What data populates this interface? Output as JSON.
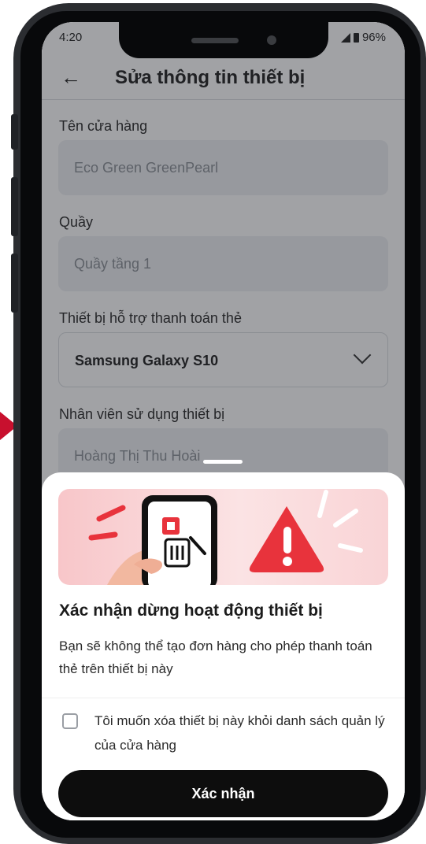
{
  "status_bar": {
    "time": "4:20",
    "battery": "96%"
  },
  "header": {
    "title": "Sửa thông tin thiết bị"
  },
  "form": {
    "store": {
      "label": "Tên cửa hàng",
      "value": "Eco Green GreenPearl"
    },
    "counter": {
      "label": "Quầy",
      "value": "Quầy tầng 1"
    },
    "device": {
      "label": "Thiết bị hỗ trợ thanh toán thẻ",
      "value": "Samsung Galaxy S10"
    },
    "staff": {
      "label": "Nhân viên sử dụng thiết bị",
      "value": "Hoàng Thị Thu Hoài"
    }
  },
  "dialog": {
    "title": "Xác nhận dừng hoạt động thiết bị",
    "message": "Bạn sẽ không thể tạo đơn hàng cho phép thanh toán thẻ trên thiết bị này",
    "checkbox_label": "Tôi muốn xóa thiết bị này khỏi danh sách quản lý của cửa hàng",
    "checkbox_checked": false,
    "confirm_label": "Xác nhận"
  },
  "colors": {
    "brand_red": "#e8333c",
    "button": "#0d0d0d"
  },
  "icons": [
    "back-arrow-icon",
    "chevron-down-icon",
    "trash-icon",
    "warning-icon",
    "checkbox-icon"
  ]
}
